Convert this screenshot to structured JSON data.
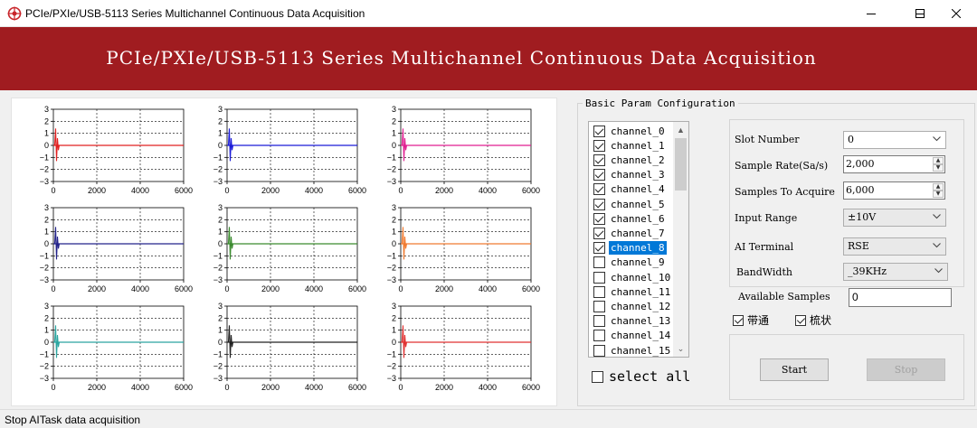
{
  "window": {
    "title": "PCIe/PXIe/USB-5113 Series Multichannel Continuous Data Acquisition",
    "icon": "logo-icon"
  },
  "banner": {
    "title": "PCIe/PXIe/USB-5113 Series Multichannel Continuous Data Acquisition",
    "color": "#a01c20"
  },
  "chart_data": [
    {
      "type": "line",
      "series": [
        {
          "color": "#e02020",
          "values": [
            [
              0,
              0
            ],
            [
              6000,
              0
            ]
          ]
        }
      ],
      "xlim": [
        0,
        6000
      ],
      "ylim": [
        -3,
        3
      ],
      "xticks": [
        "0",
        "2000",
        "4000",
        "6000"
      ],
      "yticks": [
        "3",
        "2",
        "1",
        "0",
        "−1",
        "−2",
        "−3"
      ],
      "grid": true
    },
    {
      "type": "line",
      "series": [
        {
          "color": "#1a1ad8",
          "values": [
            [
              0,
              0
            ],
            [
              6000,
              0
            ]
          ]
        }
      ],
      "xlim": [
        0,
        6000
      ],
      "ylim": [
        -3,
        3
      ],
      "xticks": [
        "0",
        "2000",
        "4000",
        "6000"
      ],
      "yticks": [
        "3",
        "2",
        "1",
        "0",
        "−1",
        "−2",
        "−3"
      ],
      "grid": true
    },
    {
      "type": "line",
      "series": [
        {
          "color": "#e01e90",
          "values": [
            [
              0,
              0
            ],
            [
              6000,
              0
            ]
          ]
        }
      ],
      "xlim": [
        0,
        6000
      ],
      "ylim": [
        -3,
        3
      ],
      "xticks": [
        "0",
        "2000",
        "4000",
        "6000"
      ],
      "yticks": [
        "3",
        "2",
        "1",
        "0",
        "−1",
        "−2",
        "−3"
      ],
      "grid": true
    },
    {
      "type": "line",
      "series": [
        {
          "color": "#23238a",
          "values": [
            [
              0,
              0
            ],
            [
              6000,
              0
            ]
          ]
        }
      ],
      "xlim": [
        0,
        6000
      ],
      "ylim": [
        -3,
        3
      ],
      "xticks": [
        "0",
        "2000",
        "4000",
        "6000"
      ],
      "yticks": [
        "3",
        "2",
        "1",
        "0",
        "−1",
        "−2",
        "−3"
      ],
      "grid": true
    },
    {
      "type": "line",
      "series": [
        {
          "color": "#3a8a2e",
          "values": [
            [
              0,
              0
            ],
            [
              6000,
              0
            ]
          ]
        }
      ],
      "xlim": [
        0,
        6000
      ],
      "ylim": [
        -3,
        3
      ],
      "xticks": [
        "0",
        "2000",
        "4000",
        "6000"
      ],
      "yticks": [
        "3",
        "2",
        "1",
        "0",
        "−1",
        "−2",
        "−3"
      ],
      "grid": true
    },
    {
      "type": "line",
      "series": [
        {
          "color": "#f07a30",
          "values": [
            [
              0,
              0
            ],
            [
              6000,
              0
            ]
          ]
        }
      ],
      "xlim": [
        0,
        6000
      ],
      "ylim": [
        -3,
        3
      ],
      "xticks": [
        "0",
        "2000",
        "4000",
        "6000"
      ],
      "yticks": [
        "3",
        "2",
        "1",
        "0",
        "−1",
        "−2",
        "−3"
      ],
      "grid": true
    },
    {
      "type": "line",
      "series": [
        {
          "color": "#2aa5a0",
          "values": [
            [
              0,
              0
            ],
            [
              6000,
              0
            ]
          ]
        }
      ],
      "xlim": [
        0,
        6000
      ],
      "ylim": [
        -3,
        3
      ],
      "xticks": [
        "0",
        "2000",
        "4000",
        "6000"
      ],
      "yticks": [
        "3",
        "2",
        "1",
        "0",
        "−1",
        "−2",
        "−3"
      ],
      "grid": true
    },
    {
      "type": "line",
      "series": [
        {
          "color": "#202020",
          "values": [
            [
              0,
              0
            ],
            [
              6000,
              0
            ]
          ]
        }
      ],
      "xlim": [
        0,
        6000
      ],
      "ylim": [
        -3,
        3
      ],
      "xticks": [
        "0",
        "2000",
        "4000",
        "6000"
      ],
      "yticks": [
        "3",
        "2",
        "1",
        "0",
        "−1",
        "−2",
        "−3"
      ],
      "grid": true
    },
    {
      "type": "line",
      "series": [
        {
          "color": "#e03030",
          "values": [
            [
              0,
              0
            ],
            [
              6000,
              0
            ]
          ]
        }
      ],
      "xlim": [
        0,
        6000
      ],
      "ylim": [
        -3,
        3
      ],
      "xticks": [
        "0",
        "2000",
        "4000",
        "6000"
      ],
      "yticks": [
        "3",
        "2",
        "1",
        "0",
        "−1",
        "−2",
        "−3"
      ],
      "grid": true
    }
  ],
  "config": {
    "group_label": "Basic Param Configuration",
    "channels": [
      {
        "label": "channel_0",
        "checked": true
      },
      {
        "label": "channel_1",
        "checked": true
      },
      {
        "label": "channel_2",
        "checked": true
      },
      {
        "label": "channel_3",
        "checked": true
      },
      {
        "label": "channel_4",
        "checked": true
      },
      {
        "label": "channel_5",
        "checked": true
      },
      {
        "label": "channel_6",
        "checked": true
      },
      {
        "label": "channel_7",
        "checked": true
      },
      {
        "label": "channel_8",
        "checked": true,
        "selected": true
      },
      {
        "label": "channel_9",
        "checked": false
      },
      {
        "label": "channel_10",
        "checked": false
      },
      {
        "label": "channel_11",
        "checked": false
      },
      {
        "label": "channel_12",
        "checked": false
      },
      {
        "label": "channel_13",
        "checked": false
      },
      {
        "label": "channel_14",
        "checked": false
      },
      {
        "label": "channel_15",
        "checked": false
      }
    ],
    "select_all": "select all",
    "slot_number_label": "Slot Number",
    "slot_number_value": "0",
    "sample_rate_label": "Sample Rate(Sa/s)",
    "sample_rate_value": "2,000",
    "samples_to_acquire_label": "Samples To Acquire",
    "samples_to_acquire_value": "6,000",
    "input_range_label": "Input Range",
    "input_range_value": "±10V",
    "ai_terminal_label": "AI Terminal",
    "ai_terminal_value": "RSE",
    "bandwidth_label": "BandWidth",
    "bandwidth_value": "_39KHz",
    "available_samples_label": "Available Samples",
    "available_samples_value": "0",
    "bandpass_label": "带通",
    "comb_label": "梳状",
    "start_label": "Start",
    "stop_label": "Stop"
  },
  "status": {
    "text": "Stop AITask data acquisition"
  }
}
